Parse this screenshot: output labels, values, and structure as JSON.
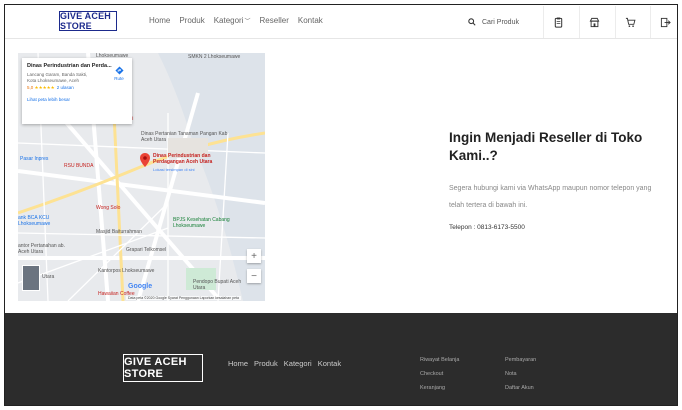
{
  "header": {
    "logo": "GIVE ACEH STORE",
    "nav": [
      {
        "label": "Home"
      },
      {
        "label": "Produk"
      },
      {
        "label": "Kategori"
      },
      {
        "label": "Reseller"
      },
      {
        "label": "Kontak"
      }
    ],
    "search": {
      "placeholder": "Cari Produk"
    },
    "icons": [
      "clipboard-icon",
      "store-icon",
      "cart-icon",
      "logout-icon"
    ]
  },
  "map": {
    "info": {
      "title": "Dinas Perindustrian dan Perda...",
      "address": "Lancang Garam, Banda Sakti, Kota Lhokseumawe, Aceh",
      "rating": "5,0",
      "stars": "★★★★★",
      "reviews": "2 ulasan",
      "link": "Lihat peta lebih besar",
      "route": "Rute"
    },
    "labels": {
      "lhok_top": "Lhokseumawe",
      "smkn": "SMKN 2 Lhokseumawe",
      "beji": "Beji",
      "pertanian": "Dinas Pertanian Tanaman Pangan Kab Aceh Utara",
      "marker": "Dinas Perindustrian dan Perdagangan Aceh Utara",
      "marker_sub": "Lokasi tersimpan di sini",
      "pasar": "Pasar Inpres",
      "rsu": "RSU BUNDA",
      "wong": "Wong Solo",
      "bca": "ank BCA KCU Lhokseumawe",
      "masjid": "Masjid Baiturrahman",
      "bpjs": "BPJS Kesehatan Cabang Lhokseumawe",
      "pertanahan": "antor Pertanahan ab. Aceh Utara",
      "grapari": "Grapari Telkomsel",
      "utara": "Utara",
      "kantorpos": "Kantorpos Lhokseumawe",
      "pendopo": "Pendopo Bupati Aceh Utara",
      "hawaiian": "Hawaiian Coffee"
    },
    "zoom_in": "+",
    "zoom_out": "−",
    "google": "Google",
    "footer": "Data peta ©2020 Google   Syarat Penggunaan   Laporkan kesalahan peta"
  },
  "reseller": {
    "title": "Ingin Menjadi Reseller di Toko Kami..?",
    "description": "Segera hubungi kami via WhatsApp maupun nomor telepon yang telah tertera di bawah ini.",
    "phone": "Telepon : 0813-6173-5500"
  },
  "footer": {
    "logo": "GIVE ACEH STORE",
    "nav": [
      "Home",
      "Produk",
      "Kategori",
      "Kontak"
    ],
    "col1": [
      "Riwayat Belanja",
      "Checkout",
      "Keranjang"
    ],
    "col2": [
      "Pembayaran",
      "Nota",
      "Daftar Akun"
    ]
  },
  "colors": {
    "brand": "#1c2a8c",
    "footer_bg": "#2c2c2c",
    "map_marker": "#ea4335"
  }
}
